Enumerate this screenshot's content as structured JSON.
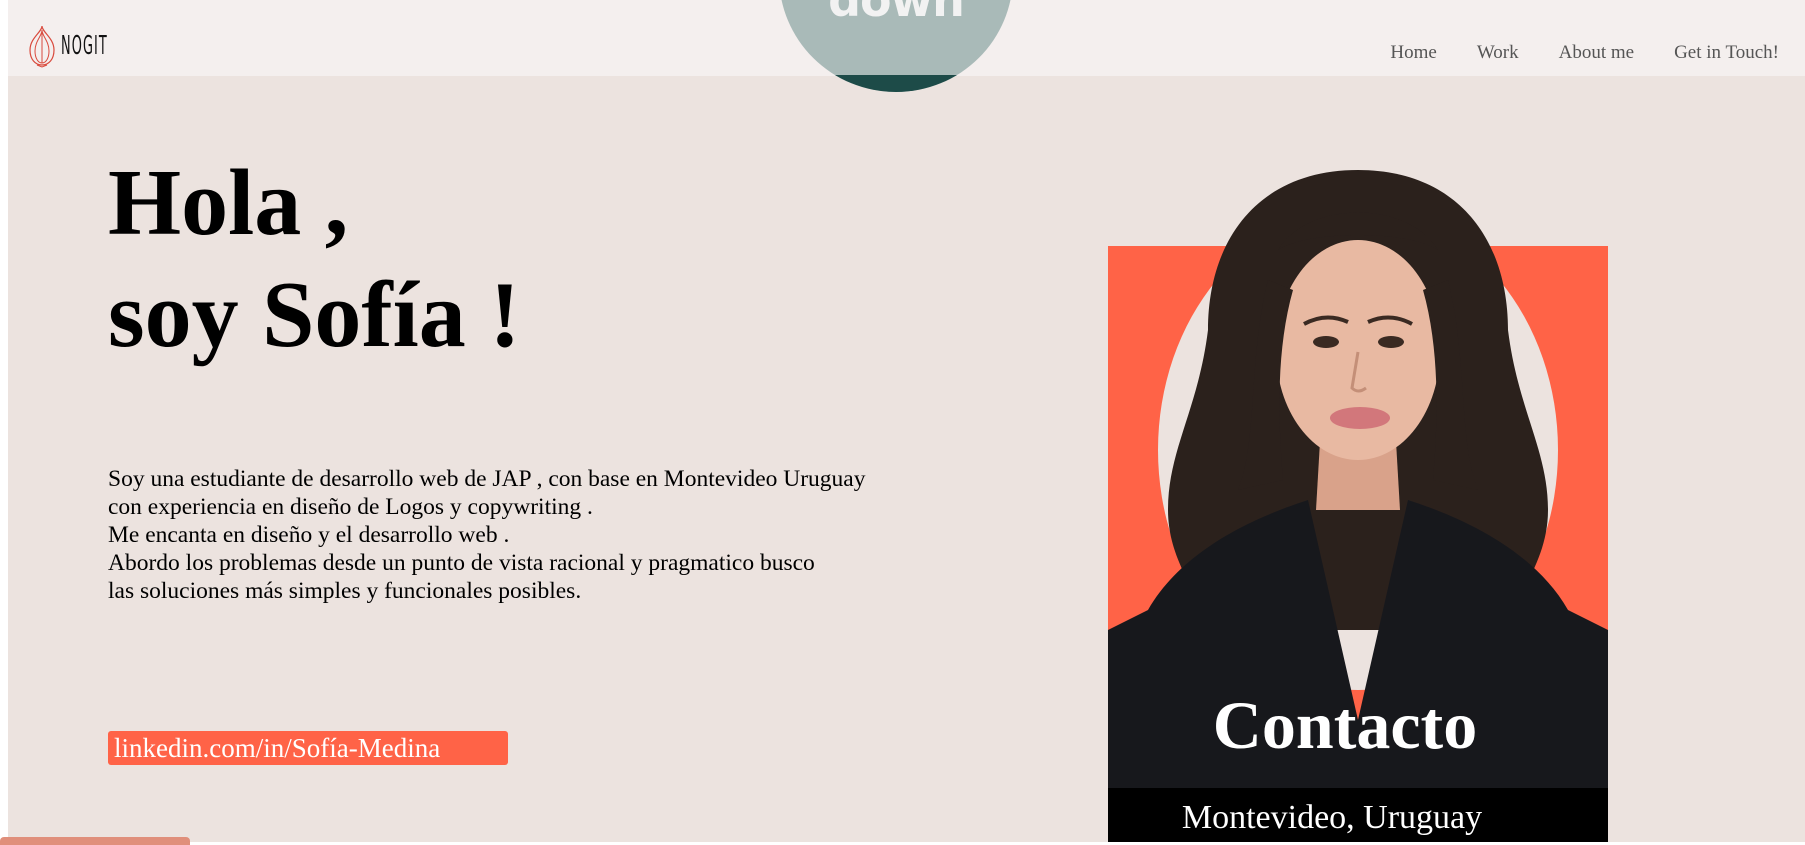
{
  "brand": {
    "logo_text": "NOGIT"
  },
  "nav": {
    "items": [
      {
        "label": "Home"
      },
      {
        "label": "Work"
      },
      {
        "label": "About me"
      },
      {
        "label": "Get in Touch!"
      }
    ]
  },
  "badge": {
    "text": "down"
  },
  "hero": {
    "greeting_line1": "Hola ,",
    "greeting_line2": "soy Sofía !",
    "bio_lines": [
      "Soy una estudiante de desarrollo web de JAP , con base en Montevideo Uruguay",
      "con experiencia en diseño de Logos y copywriting .",
      "Me encanta en diseño y el desarrollo web .",
      "Abordo los problemas desde un punto de vista racional y pragmatico busco",
      "las soluciones más simples y funcionales posibles."
    ],
    "linkedin_label": "linkedin.com/in/Sofía-Medina"
  },
  "contact_card": {
    "title": "Contacto",
    "location": "Montevideo, Uruguay"
  },
  "colors": {
    "page_bg": "#ece3df",
    "header_bg": "#f4efee",
    "accent": "#ff6347",
    "circle": "#a9bab8",
    "circle_band": "#1d4b48"
  }
}
